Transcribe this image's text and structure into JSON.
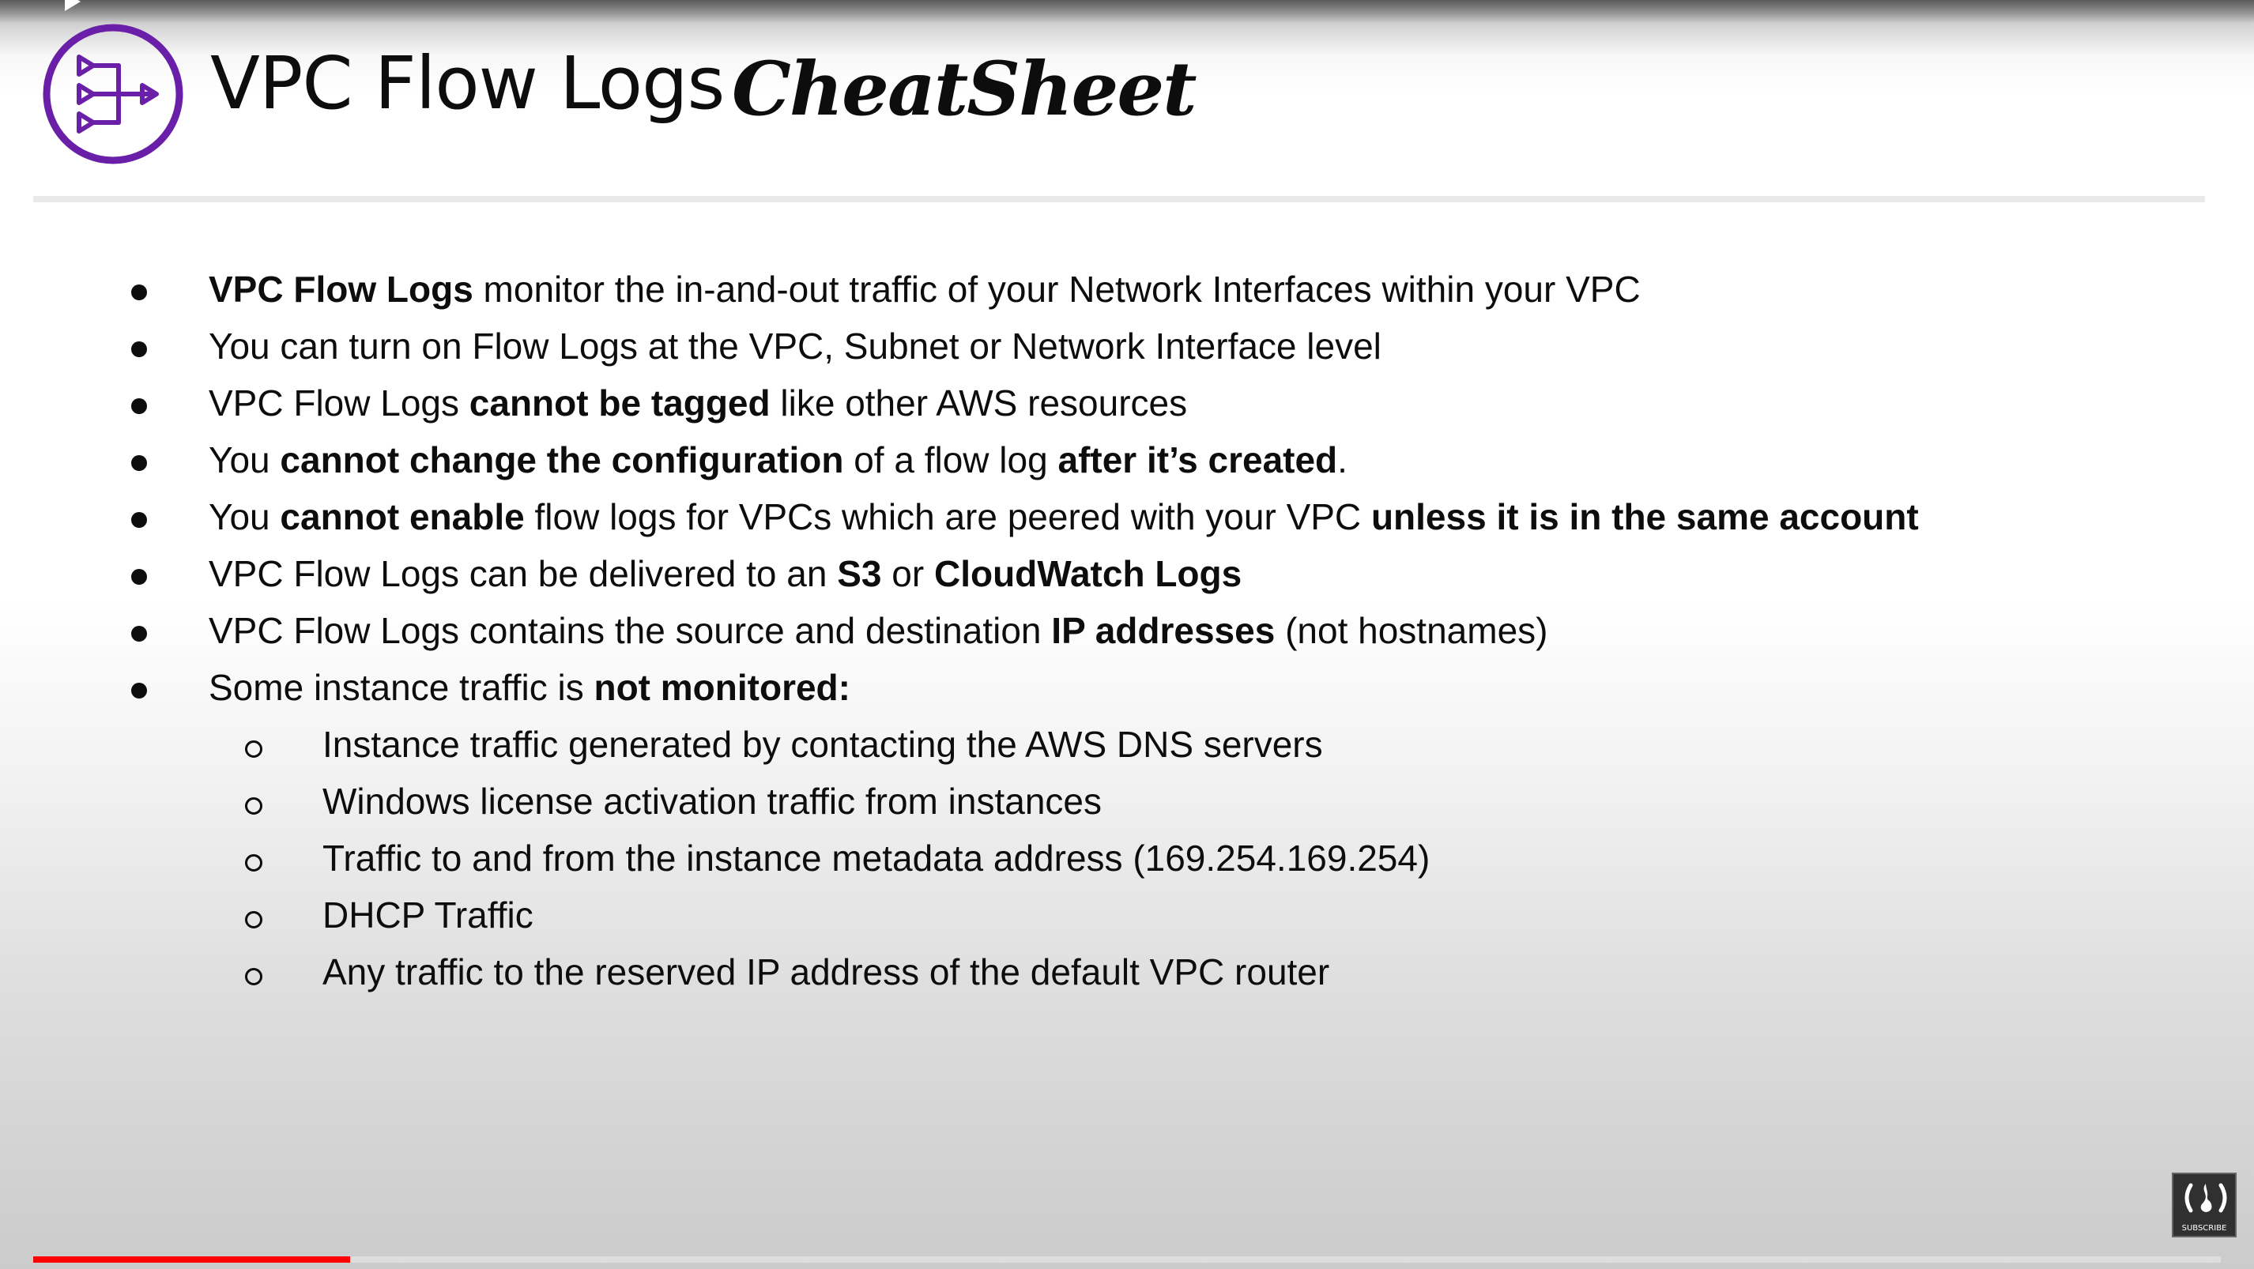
{
  "slide": {
    "title_main": "VPC Flow Logs",
    "title_script": "CheatSheet",
    "logo_icon": "flow-logs-icon",
    "accent_color": "#6a1fa8"
  },
  "bullets": [
    {
      "level": 1,
      "segments": [
        {
          "text": "VPC Flow Logs",
          "bold": true
        },
        {
          "text": " monitor the in-and-out traffic of your Network Interfaces within your VPC",
          "bold": false
        }
      ]
    },
    {
      "level": 1,
      "segments": [
        {
          "text": "You can turn on Flow Logs at the VPC, Subnet or Network Interface level",
          "bold": false
        }
      ]
    },
    {
      "level": 1,
      "segments": [
        {
          "text": "VPC Flow Logs ",
          "bold": false
        },
        {
          "text": "cannot be tagged",
          "bold": true
        },
        {
          "text": " like other AWS resources",
          "bold": false
        }
      ]
    },
    {
      "level": 1,
      "segments": [
        {
          "text": "You ",
          "bold": false
        },
        {
          "text": "cannot change the configuration",
          "bold": true
        },
        {
          "text": " of a flow log ",
          "bold": false
        },
        {
          "text": "after it’s created",
          "bold": true
        },
        {
          "text": ".",
          "bold": false
        }
      ]
    },
    {
      "level": 1,
      "segments": [
        {
          "text": "You ",
          "bold": false
        },
        {
          "text": "cannot enable",
          "bold": true
        },
        {
          "text": " flow logs for VPCs which are peered with your VPC ",
          "bold": false
        },
        {
          "text": "unless it is in the same account",
          "bold": true
        }
      ]
    },
    {
      "level": 1,
      "segments": [
        {
          "text": "VPC Flow Logs can be delivered to an ",
          "bold": false
        },
        {
          "text": "S3",
          "bold": true
        },
        {
          "text": " or ",
          "bold": false
        },
        {
          "text": "CloudWatch Logs",
          "bold": true
        }
      ]
    },
    {
      "level": 1,
      "segments": [
        {
          "text": "VPC Flow Logs contains the source and destination ",
          "bold": false
        },
        {
          "text": "IP addresses",
          "bold": true
        },
        {
          "text": " (not hostnames)",
          "bold": false
        }
      ]
    },
    {
      "level": 1,
      "segments": [
        {
          "text": "Some instance traffic is ",
          "bold": false
        },
        {
          "text": "not monitored:",
          "bold": true
        }
      ]
    },
    {
      "level": 2,
      "segments": [
        {
          "text": "Instance traffic generated by contacting the AWS DNS servers",
          "bold": false
        }
      ]
    },
    {
      "level": 2,
      "segments": [
        {
          "text": "Windows license activation traffic from instances",
          "bold": false
        }
      ]
    },
    {
      "level": 2,
      "segments": [
        {
          "text": "Traffic to and from the instance metadata address (169.254.169.254)",
          "bold": false
        }
      ]
    },
    {
      "level": 2,
      "segments": [
        {
          "text": "DHCP Traffic",
          "bold": false
        }
      ]
    },
    {
      "level": 2,
      "segments": [
        {
          "text": "Any traffic to the reserved IP address of the default VPC router",
          "bold": false
        }
      ]
    }
  ],
  "player": {
    "progress_fraction": 0.145,
    "progress_color": "#ff0000",
    "watermark_icon": "freecodecamp-icon",
    "watermark_label": "SUBSCRIBE"
  }
}
